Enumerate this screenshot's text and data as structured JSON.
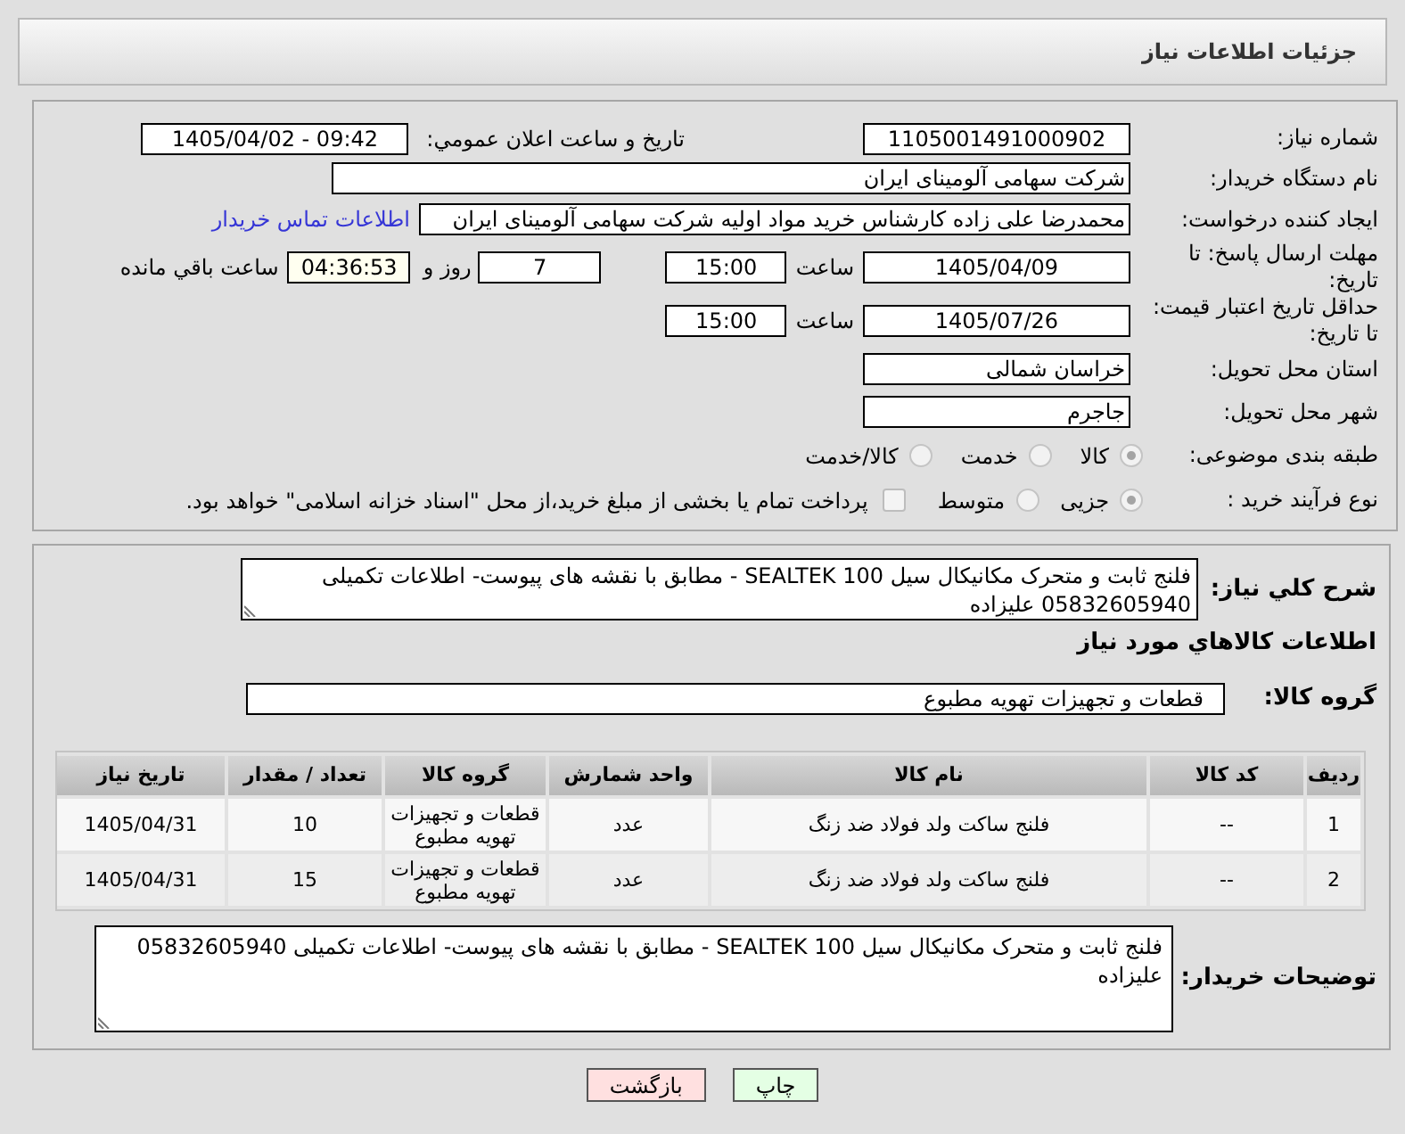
{
  "header": {
    "title": "جزئیات اطلاعات نیاز"
  },
  "details": {
    "need_number": {
      "label": "شماره نیاز:",
      "value": "1105001491000902"
    },
    "announcement": {
      "label": "تاریخ و ساعت اعلان عمومي:",
      "value": "1405/04/02 - 09:42"
    },
    "buyer_org": {
      "label": "نام دستگاه خریدار:",
      "value": "شرکت سهامی آلومینای ایران"
    },
    "requester": {
      "label": "ایجاد کننده درخواست:",
      "value": "محمدرضا علی زاده کارشناس خرید مواد اولیه شرکت سهامی آلومینای ایران",
      "link": "اطلاعات تماس خریدار"
    },
    "reply_deadline": {
      "label": "مهلت ارسال پاسخ: تا تاریخ:",
      "date": "1405/04/09",
      "time_label": "ساعت",
      "time": "15:00",
      "days": "7",
      "days_label": "روز و",
      "remaining": "04:36:53",
      "remaining_label": "ساعت باقي مانده"
    },
    "price_validity": {
      "label": "حداقل تاریخ اعتبار قیمت: تا تاریخ:",
      "date": "1405/07/26",
      "time_label": "ساعت",
      "time": "15:00"
    },
    "province": {
      "label": "استان محل تحویل:",
      "value": "خراسان شمالی"
    },
    "city": {
      "label": "شهر محل تحویل:",
      "value": "جاجرم"
    },
    "category": {
      "label": "طبقه بندی موضوعی:",
      "options": [
        {
          "label": "کالا",
          "selected": true
        },
        {
          "label": "خدمت",
          "selected": false
        },
        {
          "label": "کالا/خدمت",
          "selected": false
        }
      ]
    },
    "purchase_process": {
      "label": "نوع فرآیند خرید :",
      "options": [
        {
          "label": "جزیی",
          "selected": true
        },
        {
          "label": "متوسط",
          "selected": false
        }
      ],
      "treasury_payment": {
        "label": "پرداخت تمام یا بخشی از مبلغ خرید،از محل \"اسناد خزانه اسلامی\" خواهد بود.",
        "checked": false
      }
    }
  },
  "need": {
    "description_label": "شرح کلي نیاز:",
    "description": "فلنج ثابت و متحرک مکانیکال سیل SEALTEK 100 - مطابق با نقشه های پیوست- اطلاعات تکمیلی 05832605940 علیزاده",
    "goods_title": "اطلاعات کالاهاي مورد نیاز",
    "group_label": "گروه کالا:",
    "group": "قطعات و تجهیزات تهویه مطبوع"
  },
  "table": {
    "columns": [
      "ردیف",
      "کد کالا",
      "نام کالا",
      "واحد شمارش",
      "گروه کالا",
      "تعداد / مقدار",
      "تاریخ نیاز"
    ],
    "rows": [
      [
        "1",
        "--",
        "فلنج ساکت ولد فولاد ضد زنگ",
        "عدد",
        "قطعات و تجهیزات تهویه مطبوع",
        "10",
        "1405/04/31"
      ],
      [
        "2",
        "--",
        "فلنج ساکت ولد فولاد ضد زنگ",
        "عدد",
        "قطعات و تجهیزات تهویه مطبوع",
        "15",
        "1405/04/31"
      ]
    ]
  },
  "notes": {
    "label": "توضیحات خریدار:",
    "value": "فلنج ثابت و متحرک مکانیکال سیل SEALTEK 100 - مطابق با نقشه های پیوست- اطلاعات تکمیلی 05832605940 علیزاده"
  },
  "buttons": [
    {
      "label": "چاپ",
      "kind": "print"
    },
    {
      "label": "بازگشت",
      "kind": "back"
    }
  ]
}
